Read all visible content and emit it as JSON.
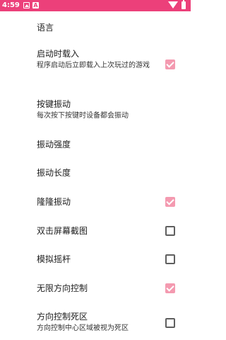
{
  "status_bar": {
    "time": "4:59",
    "icons": [
      "notification-icon",
      "a-icon",
      "wifi-icon",
      "battery-icon"
    ]
  },
  "colors": {
    "status_bar": "#ec407a",
    "checkbox_checked": "#f49ab0",
    "checkbox_unchecked_border": "#5f5f5f"
  },
  "settings": [
    {
      "title": "语言"
    },
    {
      "title": "启动时载入",
      "summary": "程序启动后立即载入上次玩过的游戏",
      "checked": true
    },
    {
      "title": "按键振动",
      "summary": "每次按下按键时设备都会振动"
    },
    {
      "title": "振动强度"
    },
    {
      "title": "振动长度"
    },
    {
      "title": "隆隆振动",
      "checked": true
    },
    {
      "title": "双击屏幕截图",
      "checked": false
    },
    {
      "title": "模拟摇杆",
      "checked": false
    },
    {
      "title": "无限方向控制",
      "checked": true
    },
    {
      "title": "方向控制死区",
      "summary": "方向控制中心区域被视为死区",
      "checked": false
    }
  ]
}
